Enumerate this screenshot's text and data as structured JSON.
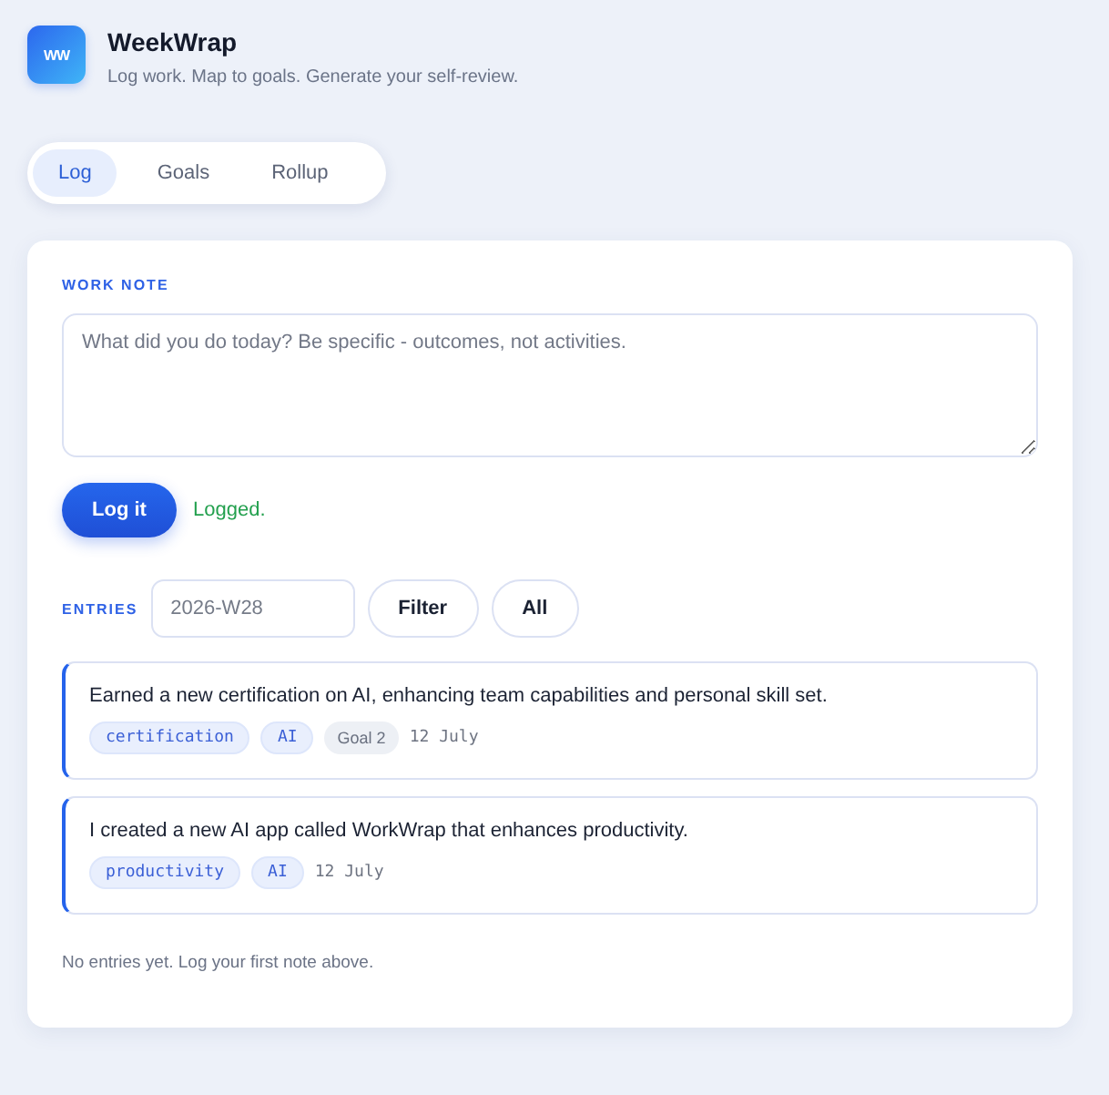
{
  "app": {
    "logo": "WW",
    "title": "WeekWrap",
    "subtitle": "Log work. Map to goals. Generate your self-review."
  },
  "tabs": [
    {
      "label": "Log",
      "selected": true
    },
    {
      "label": "Goals",
      "selected": false
    },
    {
      "label": "Rollup",
      "selected": false
    }
  ],
  "work_note": {
    "label": "WORK NOTE",
    "placeholder": "What did you do today? Be specific - outcomes, not activities.",
    "button": "Log it",
    "status": "Logged."
  },
  "entries": {
    "label": "ENTRIES",
    "week_field": {
      "placeholder": "2026-W28"
    },
    "buttons": [
      "Filter",
      "All"
    ],
    "items": [
      {
        "text": "Earned a new certification on AI, enhancing team capabilities and personal skill set.",
        "tags": [
          {
            "kind": "tag",
            "label": "certification"
          },
          {
            "kind": "tag",
            "label": "AI"
          },
          {
            "kind": "goal",
            "label": "Goal 2"
          }
        ],
        "date": "12 July"
      },
      {
        "text": "I created a new AI app called WorkWrap that enhances productivity.",
        "tags": [
          {
            "kind": "tag",
            "label": "productivity"
          },
          {
            "kind": "tag",
            "label": "AI"
          }
        ],
        "date": "12 July"
      }
    ],
    "empty_message": "No entries yet. Log your first note above."
  }
}
